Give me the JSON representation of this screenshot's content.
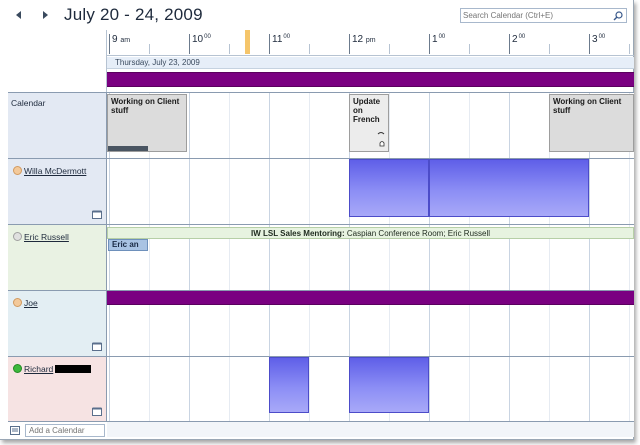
{
  "header": {
    "date_range": "July 20 - 24, 2009",
    "search_placeholder": "Search Calendar (Ctrl+E)",
    "prev_icon": "triangle-left-icon",
    "next_icon": "triangle-right-icon"
  },
  "ruler": {
    "hours": [
      {
        "label": "9",
        "suffix": "am"
      },
      {
        "label": "10",
        "suffix": "00"
      },
      {
        "label": "11",
        "suffix": "00"
      },
      {
        "label": "12",
        "suffix": "pm"
      },
      {
        "label": "1",
        "suffix": "00"
      },
      {
        "label": "2",
        "suffix": "00"
      },
      {
        "label": "3",
        "suffix": "00"
      }
    ]
  },
  "day_header": "Thursday, July 23, 2009",
  "colors": {
    "all_day_event": "#7a0081",
    "busy_block": "#6b6bef",
    "tentative_appt": "#dcdcdc",
    "mentoring_event": "#e7f3e0"
  },
  "rows": {
    "calendar": {
      "label": "Calendar",
      "appointments": [
        {
          "title": "Working on Client stuff"
        },
        {
          "title": "Update on French"
        },
        {
          "title": "Working on Client stuff"
        }
      ]
    },
    "willa": {
      "name": "Willa McDermott",
      "presence_color": "#f3c99a"
    },
    "eric": {
      "name": "Eric Russell",
      "presence_color": "#e0e0e0",
      "event_title": "IW LSL Sales Mentoring:",
      "event_detail": "Caspian Conference Room; Eric Russell",
      "chip": "Eric an"
    },
    "joe": {
      "name": "Joe",
      "presence_color": "#f3c99a"
    },
    "richard": {
      "name": "Richard",
      "presence_color": "#3cb83c"
    }
  },
  "footer": {
    "add_calendar_placeholder": "Add a Calendar"
  }
}
